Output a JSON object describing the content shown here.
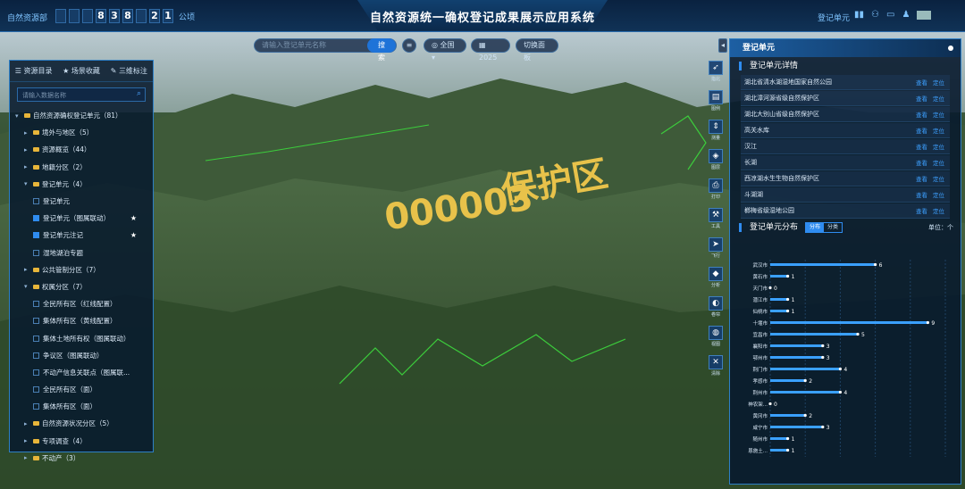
{
  "header": {
    "left_tag": "自然资源部",
    "digits": [
      "",
      "",
      "",
      "8",
      "3",
      "8",
      "",
      "2",
      "1"
    ],
    "digit_unit": "公顷",
    "title": "自然资源统一确权登记成果展示应用系统",
    "right_tag": "登记单元",
    "right_icons": [
      "bar-icon",
      "person-icon",
      "monitor-icon",
      "user-icon"
    ]
  },
  "toolbar": {
    "search_placeholder": "请输入登记单元名称",
    "search_button": "搜索",
    "region": "全国",
    "year": "2025",
    "switch_label": "切换面板"
  },
  "overlay_text": {
    "line1": "保护区",
    "line2": "000003"
  },
  "left_panel": {
    "tabs": [
      {
        "label": "资源目录",
        "icon": "layers-icon"
      },
      {
        "label": "场景收藏",
        "icon": "star-icon"
      },
      {
        "label": "三维标注",
        "icon": "marker-icon"
      }
    ],
    "search_placeholder": "请输入数据名称",
    "tree": [
      {
        "label": "自然资源确权登记单元（81）",
        "level": 0,
        "type": "folder",
        "open": true
      },
      {
        "label": "境外与地区（5）",
        "level": 1,
        "type": "folder",
        "open": false
      },
      {
        "label": "资源概览（44）",
        "level": 1,
        "type": "folder",
        "open": false
      },
      {
        "label": "地籍分区（2）",
        "level": 1,
        "type": "folder",
        "open": false
      },
      {
        "label": "登记单元（4）",
        "level": 1,
        "type": "folder",
        "open": true
      },
      {
        "label": "登记单元",
        "level": 2,
        "type": "check",
        "checked": false,
        "star": false
      },
      {
        "label": "登记单元（图属联动）",
        "level": 2,
        "type": "check",
        "checked": true,
        "star": true
      },
      {
        "label": "登记单元注记",
        "level": 2,
        "type": "check",
        "checked": true,
        "star": true
      },
      {
        "label": "湿地湖泊专题",
        "level": 2,
        "type": "check",
        "checked": false,
        "star": false
      },
      {
        "label": "公共管制分区（7）",
        "level": 1,
        "type": "folder",
        "open": false
      },
      {
        "label": "权属分区（7）",
        "level": 1,
        "type": "folder",
        "open": true
      },
      {
        "label": "全民所有区（红线配置）",
        "level": 2,
        "type": "check",
        "checked": false,
        "star": false
      },
      {
        "label": "集体所有区（黄线配置）",
        "level": 2,
        "type": "check",
        "checked": false,
        "star": false
      },
      {
        "label": "集体土地所有权（图属联动）",
        "level": 2,
        "type": "check",
        "checked": false,
        "star": false
      },
      {
        "label": "争议区（图属联动）",
        "level": 2,
        "type": "check",
        "checked": false,
        "star": false
      },
      {
        "label": "不动产信息关联点（图属联...",
        "level": 2,
        "type": "check",
        "checked": false,
        "star": false
      },
      {
        "label": "全民所有区（面）",
        "level": 2,
        "type": "check",
        "checked": false,
        "star": false
      },
      {
        "label": "集体所有区（面）",
        "level": 2,
        "type": "check",
        "checked": false,
        "star": false
      },
      {
        "label": "自然资源状况分区（5）",
        "level": 1,
        "type": "folder",
        "open": false
      },
      {
        "label": "专项调查（4）",
        "level": 1,
        "type": "folder",
        "open": false
      },
      {
        "label": "不动产（3）",
        "level": 1,
        "type": "folder",
        "open": false
      }
    ]
  },
  "tools": [
    {
      "label": "指北",
      "icon": "compass-icon"
    },
    {
      "label": "图例",
      "icon": "legend-icon"
    },
    {
      "label": "测量",
      "icon": "measure-icon"
    },
    {
      "label": "图层",
      "icon": "layers-icon"
    },
    {
      "label": "打印",
      "icon": "print-icon"
    },
    {
      "label": "工具",
      "icon": "toolbox-icon"
    },
    {
      "label": "飞行",
      "icon": "fly-icon"
    },
    {
      "label": "分析",
      "icon": "cube-icon"
    },
    {
      "label": "卷帘",
      "icon": "swipe-icon"
    },
    {
      "label": "视图",
      "icon": "globe-icon"
    },
    {
      "label": "清除",
      "icon": "trash-icon"
    }
  ],
  "right_panel": {
    "title": "登记单元",
    "details_title": "登记单元详情",
    "units": [
      {
        "name": "湖北省清水湖湿地国家自然公园",
        "actions": [
          "查看",
          "定位"
        ]
      },
      {
        "name": "湖北漳河源省级自然保护区",
        "actions": [
          "查看",
          "定位"
        ]
      },
      {
        "name": "湖北大别山省级自然保护区",
        "actions": [
          "查看",
          "定位"
        ]
      },
      {
        "name": "高关水库",
        "actions": [
          "查看",
          "定位"
        ]
      },
      {
        "name": "汉江",
        "actions": [
          "查看",
          "定位"
        ]
      },
      {
        "name": "长湖",
        "actions": [
          "查看",
          "定位"
        ]
      },
      {
        "name": "西凉湖水生生物自然保护区",
        "actions": [
          "查看",
          "定位"
        ]
      },
      {
        "name": "斗湖湖",
        "actions": [
          "查看",
          "定位"
        ]
      },
      {
        "name": "榔梅省级湿地公园",
        "actions": [
          "查看",
          "定位"
        ]
      }
    ],
    "dist_title": "登记单元分布",
    "dist_tabs": [
      "分布",
      "分类"
    ],
    "unit_label": "单位：个"
  },
  "chart_data": {
    "type": "bar",
    "orientation": "horizontal",
    "categories": [
      "武汉市",
      "黄石市",
      "天门市",
      "潜江市",
      "仙桃市",
      "十堰市",
      "宜昌市",
      "襄阳市",
      "鄂州市",
      "荆门市",
      "孝感市",
      "荆州市",
      "神农架...",
      "黄冈市",
      "咸宁市",
      "随州市",
      "恩施土..."
    ],
    "values": [
      6,
      1,
      0,
      1,
      1,
      9,
      5,
      3,
      3,
      4,
      2,
      4,
      0,
      2,
      3,
      1,
      1
    ],
    "xlim": [
      0,
      10
    ],
    "grid": true,
    "bar_color": "#3aa0ff"
  }
}
